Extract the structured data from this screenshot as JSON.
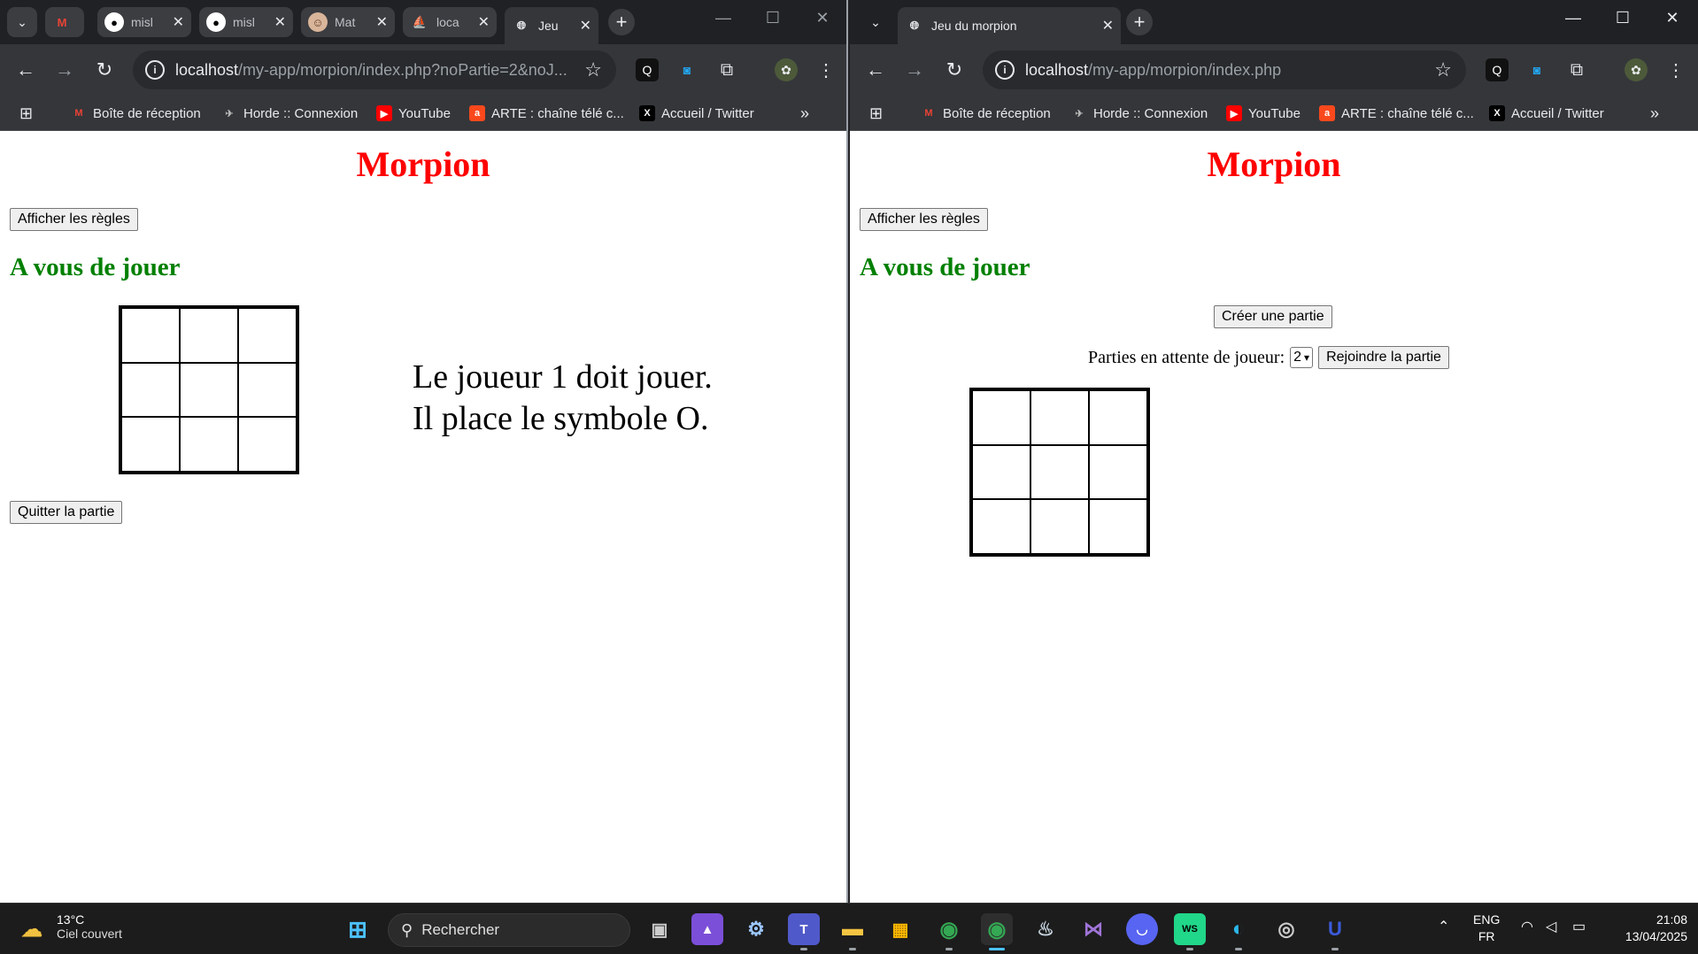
{
  "left_window": {
    "tabs": [
      {
        "icon": "gmail-icon",
        "title": "",
        "active": false
      },
      {
        "icon": "github-icon",
        "title": "misl",
        "active": false
      },
      {
        "icon": "github-icon",
        "title": "misl",
        "active": false
      },
      {
        "icon": "avatar-icon",
        "title": "Mat",
        "active": false
      },
      {
        "icon": "phpmyadmin-icon",
        "title": "loca",
        "active": false
      },
      {
        "icon": "globe-icon",
        "title": "Jeu",
        "active": true
      }
    ],
    "url_host": "localhost",
    "url_path": "/my-app/morpion/index.php?noPartie=2&noJ...",
    "page": {
      "title": "Morpion",
      "rules_button": "Afficher les règles",
      "turn_heading": "A vous de jouer",
      "status_line1": "Le joueur 1 doit jouer.",
      "status_line2": "Il place le symbole O.",
      "quit_button": "Quitter la partie"
    }
  },
  "right_window": {
    "tab_title": "Jeu du morpion",
    "url_host": "localhost",
    "url_path": "/my-app/morpion/index.php",
    "page": {
      "title": "Morpion",
      "rules_button": "Afficher les règles",
      "turn_heading": "A vous de jouer",
      "create_button": "Créer une partie",
      "waiting_label": "Parties en attente de joueur:",
      "waiting_select_value": "2",
      "join_button": "Rejoindre la partie"
    }
  },
  "bookmarks": [
    {
      "icon": "gmail-icon",
      "label": "Boîte de réception"
    },
    {
      "icon": "horde-icon",
      "label": "Horde :: Connexion"
    },
    {
      "icon": "youtube-icon",
      "label": "YouTube"
    },
    {
      "icon": "arte-icon",
      "label": "ARTE : chaîne télé c..."
    },
    {
      "icon": "x-icon",
      "label": "Accueil / Twitter"
    }
  ],
  "taskbar": {
    "weather_temp": "13°C",
    "weather_desc": "Ciel couvert",
    "search_placeholder": "Rechercher",
    "lang_top": "ENG",
    "lang_bottom": "FR",
    "time": "21:08",
    "date": "13/04/2025"
  },
  "colors": {
    "title_red": "#ff0000",
    "heading_green": "#008000",
    "chrome_dark": "#202124",
    "chrome_toolbar": "#35363a",
    "taskbar": "#1c1c1c"
  }
}
